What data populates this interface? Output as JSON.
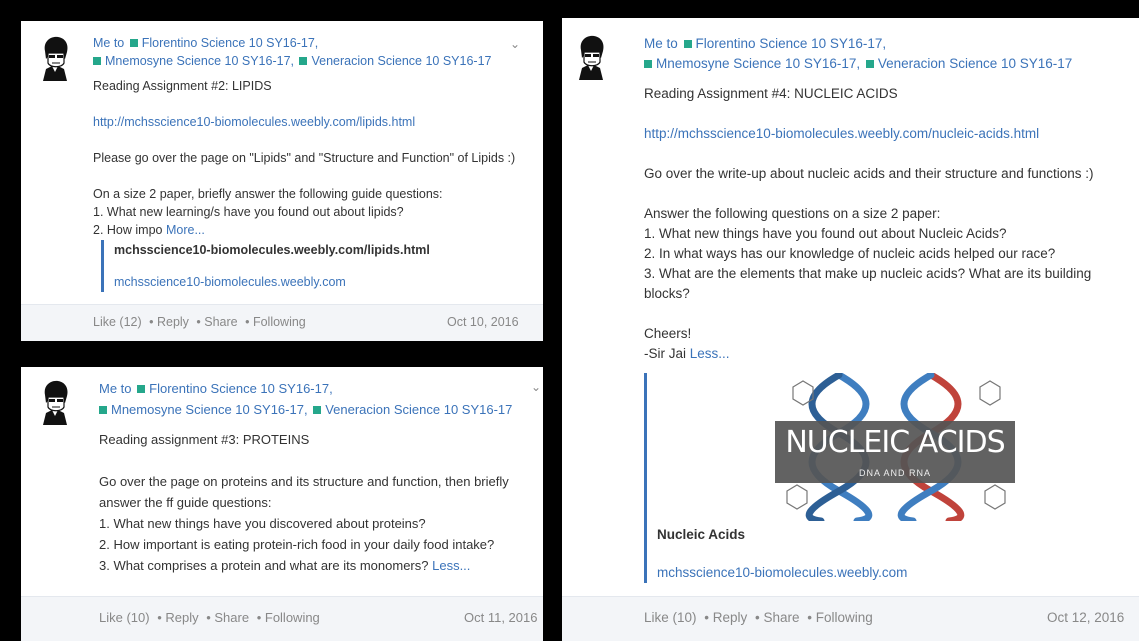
{
  "posts": [
    {
      "recipients": {
        "lead": "Me to",
        "r1": "Florentino Science 10 SY16-17,",
        "r2": "Mnemosyne Science 10 SY16-17,",
        "r3": "Veneracion Science 10 SY16-17"
      },
      "title": "Reading Assignment #2: LIPIDS",
      "link": "http://mchsscience10-biomolecules.weebly.com/lipids.html",
      "line1": "Please go over the page on \"Lipids\" and \"Structure and Function\" of Lipids :)",
      "line2": "On a size 2 paper, briefly answer the following guide questions:",
      "line3": "1. What new learning/s have you found out about lipids?",
      "line4": "2. How impo",
      "more": "More...",
      "preview_title": "mchsscience10-biomolecules.weebly.com/lipids.html",
      "preview_link": "mchsscience10-biomolecules.weebly.com",
      "footer": {
        "like": "Like (12)",
        "reply": "Reply",
        "share": "Share",
        "following": "Following",
        "date": "Oct 10, 2016"
      }
    },
    {
      "recipients": {
        "lead": "Me to",
        "r1": "Florentino Science 10 SY16-17,",
        "r2": "Mnemosyne Science 10 SY16-17,",
        "r3": "Veneracion Science 10 SY16-17"
      },
      "title": "Reading assignment #3: PROTEINS",
      "line1": "Go over the page on proteins and its structure and function, then briefly",
      "line2": "answer the ff guide questions:",
      "line3": "1. What new things have you discovered about proteins?",
      "line4": "2. How important is eating protein-rich food in your daily food intake?",
      "line5": "3. What comprises a protein and what are its monomers?",
      "less": "Less...",
      "footer": {
        "like": "Like (10)",
        "reply": "Reply",
        "share": "Share",
        "following": "Following",
        "date": "Oct 11, 2016"
      }
    },
    {
      "recipients": {
        "lead": "Me to",
        "r1": "Florentino Science 10 SY16-17,",
        "r2": "Mnemosyne Science 10 SY16-17,",
        "r3": "Veneracion Science 10 SY16-17"
      },
      "title": "Reading Assignment #4: NUCLEIC ACIDS",
      "link": "http://mchsscience10-biomolecules.weebly.com/nucleic-acids.html",
      "line1": "Go over the write-up about nucleic acids and their structure and functions :)",
      "line2": "Answer the following questions on a size 2 paper:",
      "line3": "1. What new things have you found out about Nucleic Acids?",
      "line4": "2. In what ways has our knowledge of nucleic acids helped our race?",
      "line5": "3. What are the elements that make up nucleic acids? What are its building",
      "line6": "blocks?",
      "line7": "Cheers!",
      "line8": "-Sir Jai",
      "less": "Less...",
      "thumb_title": "NUCLEIC ACIDS",
      "thumb_sub": "DNA AND RNA",
      "attach_title": "Nucleic Acids",
      "attach_link": "mchsscience10-biomolecules.weebly.com",
      "footer": {
        "like": "Like (10)",
        "reply": "Reply",
        "share": "Share",
        "following": "Following",
        "date": "Oct 12, 2016"
      }
    }
  ],
  "colors": {
    "link": "#3b73b9",
    "group_badge": "#25a78b",
    "footer_bg": "#f3f5f8"
  },
  "icons": {
    "avatar": "user-avatar-icon",
    "expand": "chevron-down-icon",
    "group": "group-badge-icon"
  }
}
